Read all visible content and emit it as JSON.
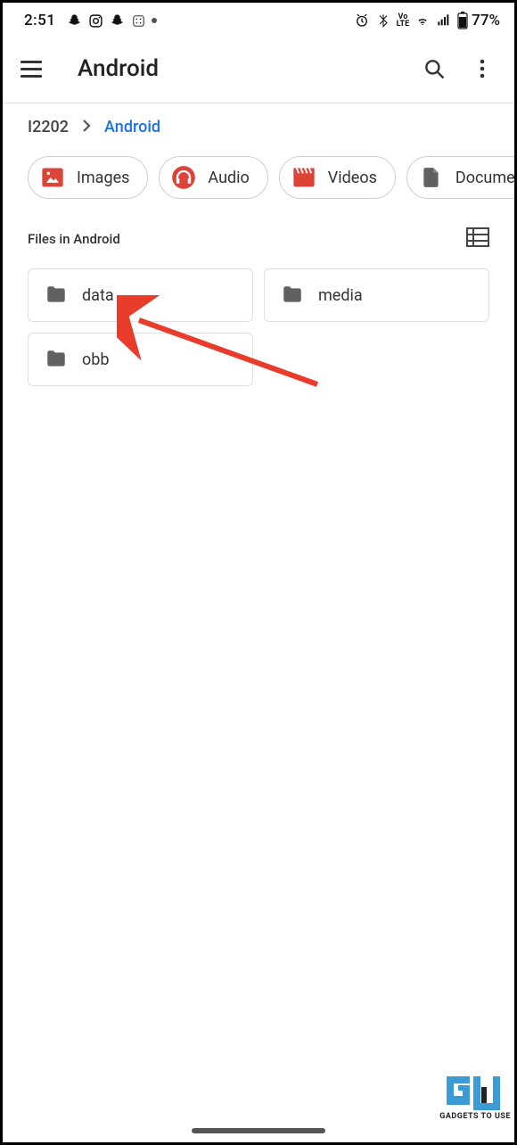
{
  "statusbar": {
    "time": "2:51",
    "battery": "77%"
  },
  "appbar": {
    "title": "Android"
  },
  "breadcrumb": {
    "root": "I2202",
    "current": "Android"
  },
  "chips": [
    {
      "label": "Images"
    },
    {
      "label": "Audio"
    },
    {
      "label": "Videos"
    },
    {
      "label": "Documents"
    }
  ],
  "section": {
    "label": "Files in Android"
  },
  "folders": [
    {
      "name": "data"
    },
    {
      "name": "media"
    },
    {
      "name": "obb"
    }
  ],
  "watermark": {
    "text": "GADGETS TO USE"
  },
  "colors": {
    "accentRed": "#db4437",
    "link": "#1a73e8",
    "folder": "#616161"
  }
}
